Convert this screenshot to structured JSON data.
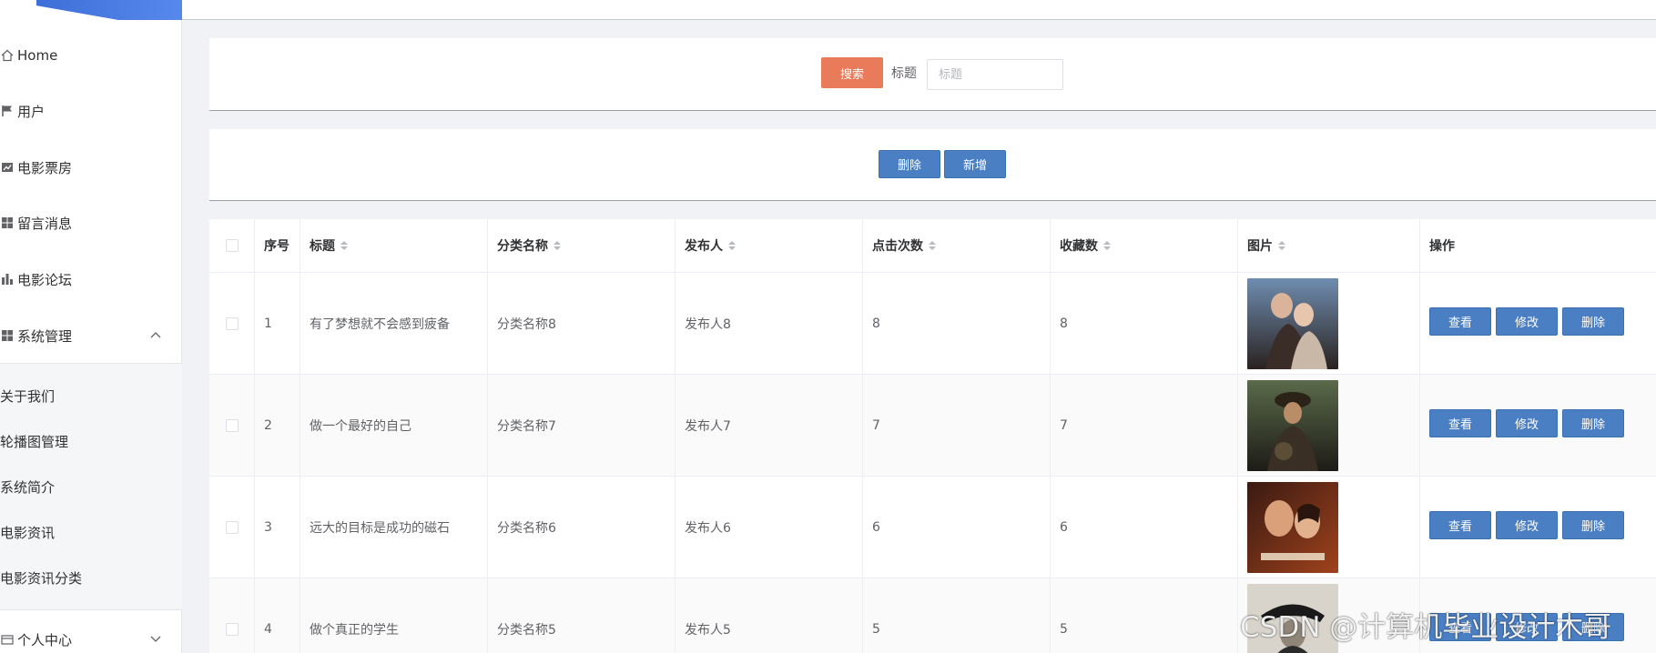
{
  "sidebar": {
    "menu": [
      {
        "label": "Home",
        "icon": "home-icon"
      },
      {
        "label": "用户",
        "icon": "flag-icon"
      },
      {
        "label": "电影票房",
        "icon": "line-chart-icon"
      },
      {
        "label": "留言消息",
        "icon": "grid-icon"
      },
      {
        "label": "电影论坛",
        "icon": "bar-chart-icon"
      },
      {
        "label": "系统管理",
        "icon": "grid-icon",
        "expanded": true
      }
    ],
    "submenu": [
      "关于我们",
      "轮播图管理",
      "系统简介",
      "电影资讯",
      "电影资讯分类"
    ],
    "personal": {
      "label": "个人中心",
      "icon": "card-icon"
    }
  },
  "search": {
    "button_label": "搜索",
    "field_label": "标题",
    "placeholder": "标题"
  },
  "actions": {
    "delete_label": "删除",
    "add_label": "新增"
  },
  "table": {
    "headers": [
      "序号",
      "标题",
      "分类名称",
      "发布人",
      "点击次数",
      "收藏数",
      "图片",
      "操作"
    ],
    "rows": [
      {
        "index": "1",
        "title": "有了梦想就不会感到疲备",
        "category": "分类名称8",
        "publisher": "发布人8",
        "clicks": "8",
        "favorites": "8"
      },
      {
        "index": "2",
        "title": "做一个最好的自己",
        "category": "分类名称7",
        "publisher": "发布人7",
        "clicks": "7",
        "favorites": "7"
      },
      {
        "index": "3",
        "title": "远大的目标是成功的磁石",
        "category": "分类名称6",
        "publisher": "发布人6",
        "clicks": "6",
        "favorites": "6"
      },
      {
        "index": "4",
        "title": "做个真正的学生",
        "category": "分类名称5",
        "publisher": "发布人5",
        "clicks": "5",
        "favorites": "5"
      }
    ],
    "row_actions": {
      "view": "查看",
      "edit": "修改",
      "delete": "删除"
    }
  },
  "watermark": "CSDN @计算机毕业设计木哥",
  "colors": {
    "search_button": "#ea7b5a",
    "primary_button": "#4a7fc4",
    "sidebar_accent": "#3d6fd8"
  }
}
